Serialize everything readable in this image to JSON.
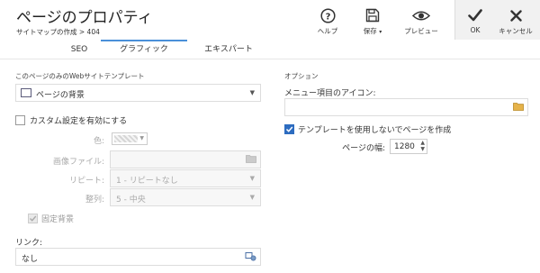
{
  "header": {
    "title": "ページのプロパティ",
    "breadcrumb": "サイトマップの作成 > 404"
  },
  "toolbar": {
    "help": "ヘルプ",
    "save": "保存",
    "preview": "プレビュー",
    "ok": "OK",
    "cancel": "キャンセル"
  },
  "tabs": [
    "SEO",
    "グラフィック",
    "エキスパート"
  ],
  "left": {
    "template_section": "このページのみのWebサイトテンプレート",
    "template_value": "ページの背景",
    "custom_enable": "カスタム設定を有効にする",
    "color_label": "色:",
    "image_label": "画像ファイル:",
    "repeat_label": "リピート:",
    "repeat_value": "1 - リピートなし",
    "align_label": "整列:",
    "align_value": "5 - 中央",
    "fixed_bg": "固定背景",
    "link_label": "リンク:",
    "link_value": "なし"
  },
  "right": {
    "options_section": "オプション",
    "menu_icon_label": "メニュー項目のアイコン:",
    "create_without_template": "テンプレートを使用しないでページを作成",
    "page_width_label": "ページの幅:",
    "page_width_value": "1280"
  }
}
